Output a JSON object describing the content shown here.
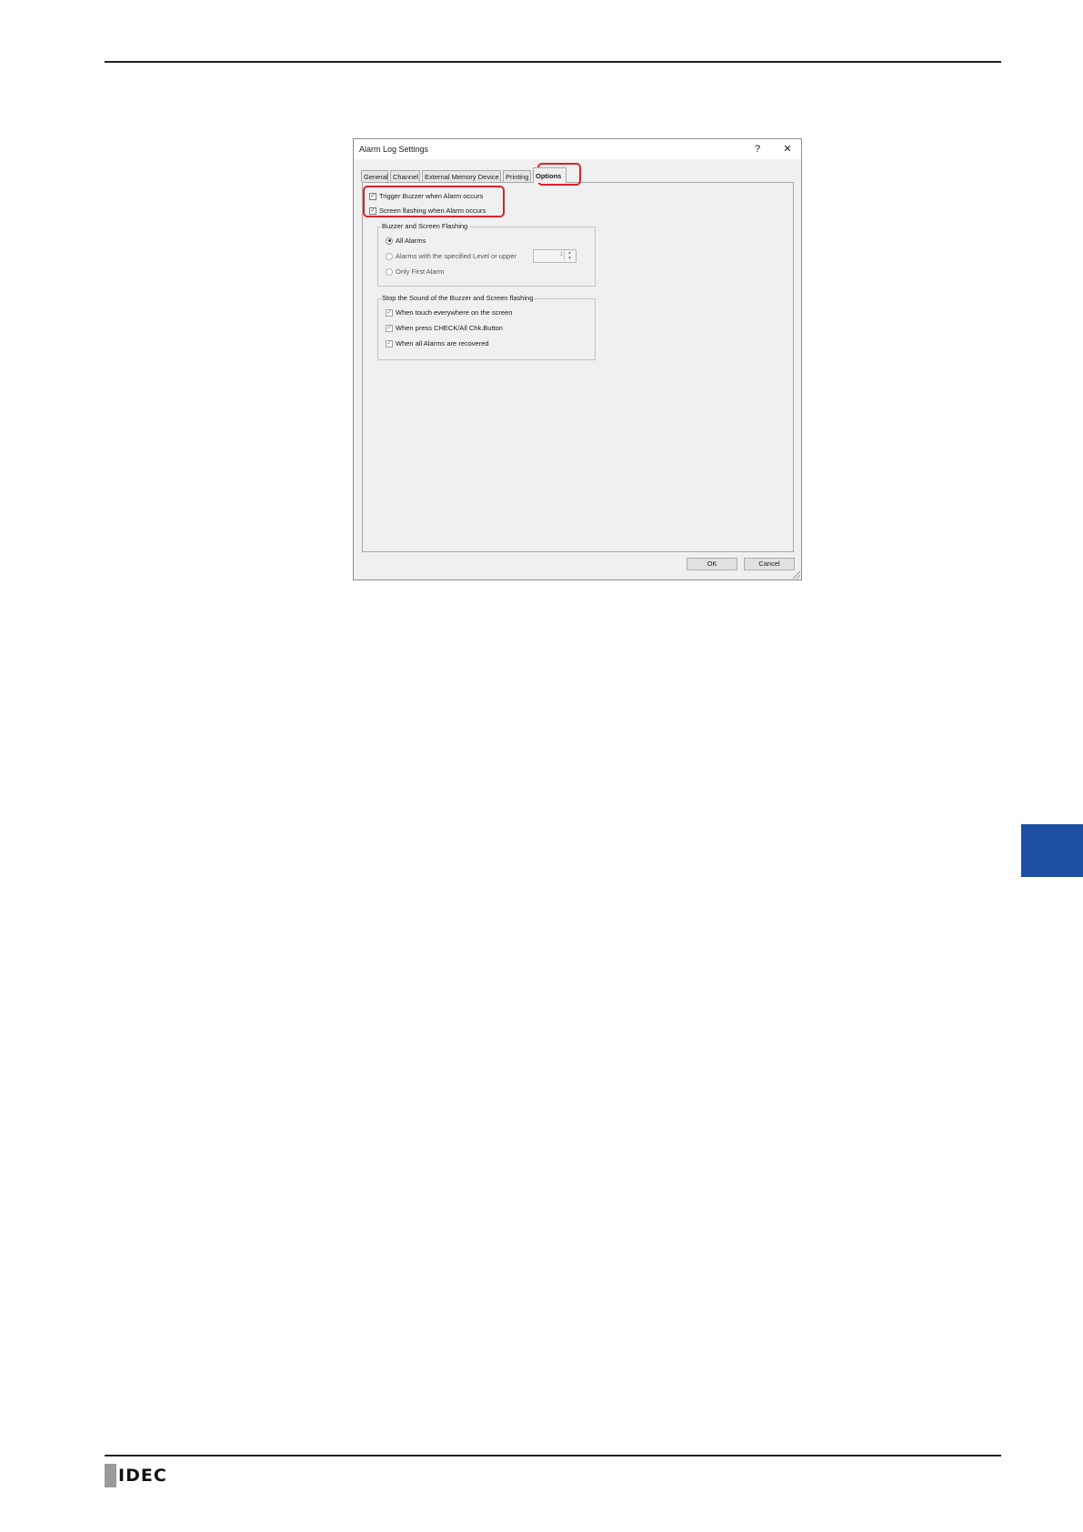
{
  "dialog": {
    "title": "Alarm Log Settings",
    "help_label": "?",
    "close_label": "✕",
    "tabs": [
      {
        "label": "General"
      },
      {
        "label": "Channel"
      },
      {
        "label": "External Memory Device"
      },
      {
        "label": "Printing"
      },
      {
        "label": "Options"
      }
    ],
    "active_tab": "Options",
    "options": {
      "trigger_buzzer": {
        "label": "Trigger Buzzer when Alarm occurs",
        "checked": true
      },
      "screen_flashing": {
        "label": "Screen flashing when Alarm occurs",
        "checked": true
      },
      "buzzer_group": {
        "legend": "Buzzer and Screen Flashing",
        "radios": [
          {
            "label": "All Alarms",
            "selected": true
          },
          {
            "label": "Alarms with the specified Level or upper",
            "selected": false
          },
          {
            "label": "Only First Alarm",
            "selected": false
          }
        ],
        "level_value": "1",
        "spin_up": "▲",
        "spin_down": "▼"
      },
      "stop_group": {
        "legend": "Stop the Sound of the Buzzer and Screen flashing",
        "checks": [
          {
            "label": "When touch everywhere on the screen",
            "checked": true
          },
          {
            "label": "When press CHECK/All Chk.Button",
            "checked": true
          },
          {
            "label": "When all Alarms are recovered",
            "checked": true
          }
        ]
      }
    },
    "buttons": {
      "ok": "OK",
      "cancel": "Cancel"
    },
    "check_mark": "✓"
  },
  "footer": {
    "logo_text": "IDEC"
  },
  "colors": {
    "chapter_tab": "#1e4fa3",
    "highlight": "#e0202a"
  }
}
